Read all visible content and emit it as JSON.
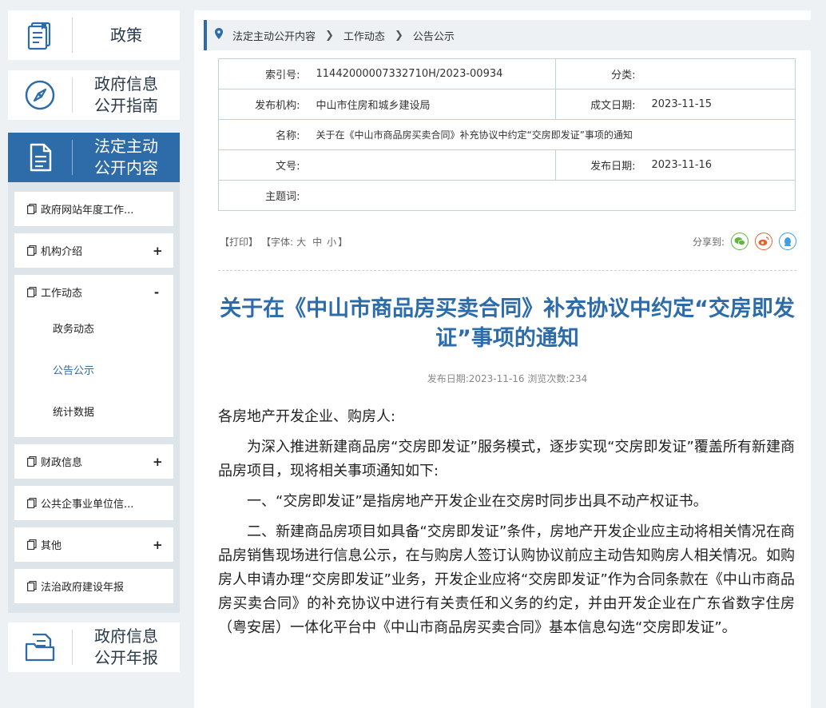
{
  "sidebar": {
    "cards": [
      {
        "label_lines": [
          "政策"
        ],
        "icon": "book-icon"
      },
      {
        "label_lines": [
          "政府信息",
          "公开指南"
        ],
        "icon": "compass-icon"
      },
      {
        "label_lines": [
          "法定主动",
          "公开内容"
        ],
        "icon": "document-icon",
        "active": true
      },
      {
        "label_lines": [
          "政府信息",
          "公开年报"
        ],
        "icon": "folder-icon"
      }
    ],
    "menu": [
      {
        "label": "政府网站年度工作...",
        "toggle": ""
      },
      {
        "label": "机构介绍",
        "toggle": "+"
      },
      {
        "label": "工作动态",
        "toggle": "-",
        "children": [
          "政务动态",
          "公告公示",
          "统计数据"
        ],
        "current_child": "公告公示"
      },
      {
        "label": "财政信息",
        "toggle": "+"
      },
      {
        "label": "公共企事业单位信...",
        "toggle": ""
      },
      {
        "label": "其他",
        "toggle": "+"
      },
      {
        "label": "法治政府建设年报",
        "toggle": ""
      }
    ]
  },
  "breadcrumb": [
    "法定主动公开内容",
    "工作动态",
    "公告公示"
  ],
  "meta": {
    "index_label": "索引号:",
    "index_value": "11442000007332710H/2023-00934",
    "category_label": "分类:",
    "category_value": "",
    "publisher_label": "发布机构:",
    "publisher_value": "中山市住房和城乡建设局",
    "created_label": "成文日期:",
    "created_value": "2023-11-15",
    "name_label": "名称:",
    "name_value": "关于在《中山市商品房买卖合同》补充协议中约定“交房即发证”事项的通知",
    "docno_label": "文号:",
    "docno_value": "",
    "published_label": "发布日期:",
    "published_value": "2023-11-16",
    "subject_label": "主题词:",
    "subject_value": ""
  },
  "tools": {
    "print": "【打印】",
    "font_prefix": "【字体:",
    "font_large": "大",
    "font_medium": "中",
    "font_small": "小",
    "font_suffix": "】",
    "share_label": "分享到:",
    "share_icons": [
      {
        "icon": "wechat-icon",
        "color": "#5fb83c"
      },
      {
        "icon": "weibo-icon",
        "color": "#e8612c"
      },
      {
        "icon": "qq-icon",
        "color": "#3f9ee8"
      }
    ]
  },
  "article": {
    "title": "关于在《中山市商品房买卖合同》补充协议中约定“交房即发证”事项的通知",
    "pubinfo": "发布日期:2023-11-16  浏览次数:234",
    "paragraphs": [
      "各房地产开发企业、购房人:",
      "为深入推进新建商品房“交房即发证”服务模式，逐步实现“交房即发证”覆盖所有新建商品房项目，现将相关事项通知如下:",
      "一、“交房即发证”是指房地产开发企业在交房时同步出具不动产权证书。",
      "二、新建商品房项目如具备“交房即发证”条件，房地产开发企业应主动将相关情况在商品房销售现场进行信息公示，在与购房人签订认购协议前应主动告知购房人相关情况。如购房人申请办理“交房即发证”业务，开发企业应将“交房即发证”作为合同条款在《中山市商品房买卖合同》的补充协议中进行有关责任和义务的约定，并由开发企业在广东省数字住房（粤安居）一体化平台中《中山市商品房买卖合同》基本信息勾选“交房即发证”。"
    ]
  },
  "colors": {
    "accent": "#2d6ca8",
    "sidebar_bg": "#dde4ea",
    "page_bg": "#eef1f4"
  }
}
